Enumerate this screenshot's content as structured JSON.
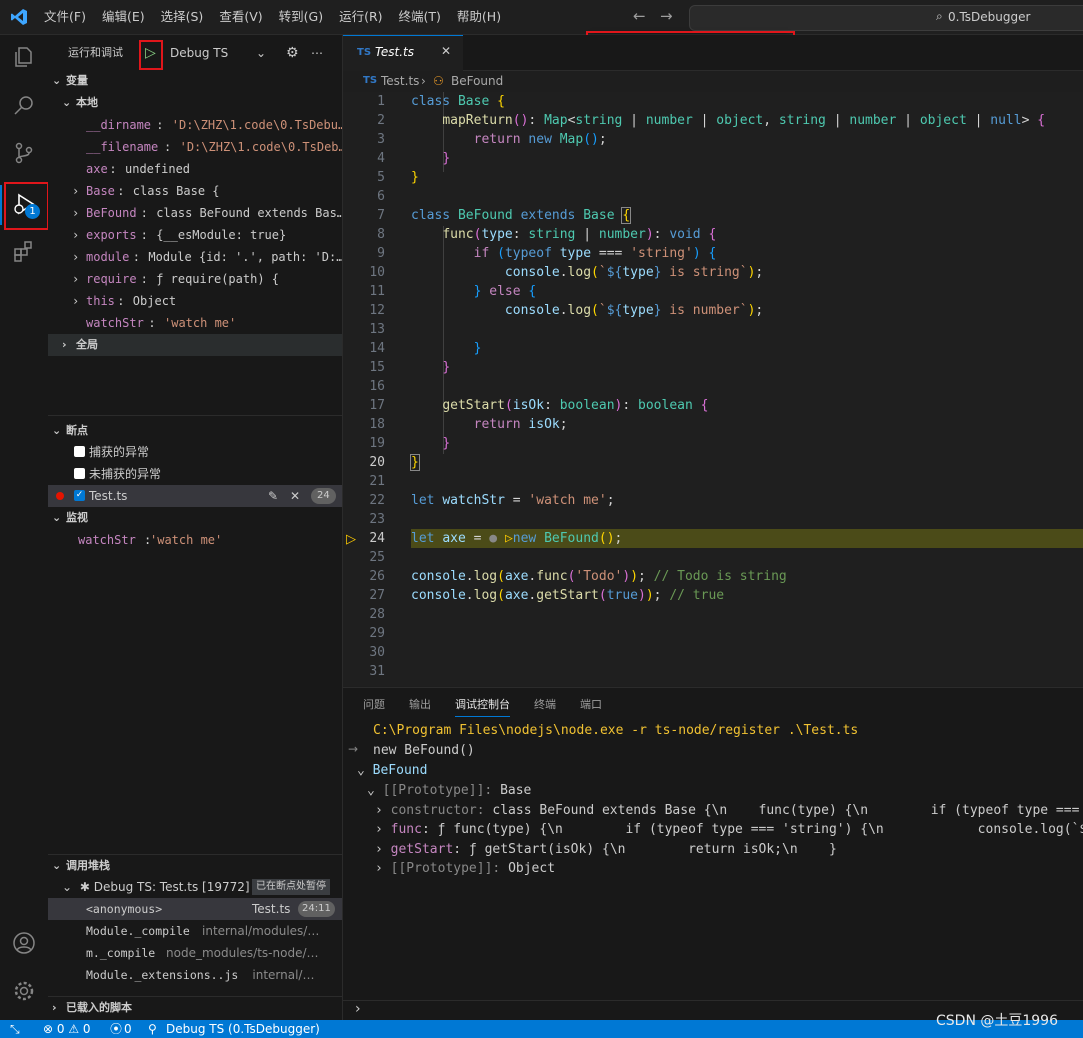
{
  "menu": [
    "文件(F)",
    "编辑(E)",
    "选择(S)",
    "查看(V)",
    "转到(G)",
    "运行(R)",
    "终端(T)",
    "帮助(H)"
  ],
  "search_text": "0.TsDebugger",
  "sidebar": {
    "title": "运行和调试",
    "config": "Debug TS",
    "variables_header": "变量",
    "local_header": "本地",
    "variables": [
      {
        "name": "__dirname",
        "value": "'D:\\ZHZ\\1.code\\0.TsDebu…",
        "kind": "str",
        "expand": false
      },
      {
        "name": "__filename",
        "value": "'D:\\ZHZ\\1.code\\0.TsDeb…",
        "kind": "str",
        "expand": false
      },
      {
        "name": "axe",
        "value": "undefined",
        "kind": "plain",
        "expand": false
      },
      {
        "name": "Base",
        "value": "class Base {",
        "kind": "plain",
        "expand": true
      },
      {
        "name": "BeFound",
        "value": "class BeFound extends Bas…",
        "kind": "plain",
        "expand": true
      },
      {
        "name": "exports",
        "value": "{__esModule: true}",
        "kind": "plain",
        "expand": true
      },
      {
        "name": "module",
        "value": "Module {id: '.', path: 'D:…",
        "kind": "plain",
        "expand": true
      },
      {
        "name": "require",
        "value": "ƒ require(path) {",
        "kind": "plain",
        "expand": true
      },
      {
        "name": "this",
        "value": "Object",
        "kind": "plain",
        "expand": true
      },
      {
        "name": "watchStr",
        "value": "'watch me'",
        "kind": "str",
        "expand": false
      }
    ],
    "global_header": "全局",
    "breakpoints_header": "断点",
    "breakpoints": [
      "捕获的异常",
      "未捕获的异常"
    ],
    "bp_file": "Test.ts",
    "bp_line": "24",
    "watch_header": "监视",
    "watch_name": "watchStr",
    "watch_value": "'watch me'",
    "callstack_header": "调用堆栈",
    "session": "Debug TS: Test.ts [19772]",
    "paused": "已在断点处暂停",
    "frames": [
      {
        "fn": "<anonymous>",
        "src": "Test.ts",
        "pos": "24:11"
      },
      {
        "fn": "Module._compile",
        "src": "internal/modules/…",
        "pos": ""
      },
      {
        "fn": "m._compile",
        "src": "node_modules/ts-node/…",
        "pos": ""
      },
      {
        "fn": "Module._extensions..js",
        "src": "internal/…",
        "pos": ""
      }
    ],
    "loaded_scripts": "已载入的脚本",
    "debug_badge": "1"
  },
  "editor": {
    "tab": "Test.ts",
    "tab_lang": "TS",
    "breadcrumb_file": "Test.ts",
    "breadcrumb_symbol": "BeFound",
    "line_numbers": [
      "1",
      "2",
      "3",
      "4",
      "5",
      "6",
      "7",
      "8",
      "9",
      "10",
      "11",
      "12",
      "13",
      "14",
      "15",
      "16",
      "17",
      "18",
      "19",
      "20",
      "21",
      "22",
      "23",
      "24",
      "25",
      "26",
      "27",
      "28",
      "29",
      "30",
      "31"
    ]
  },
  "panel": {
    "tabs": [
      "问题",
      "输出",
      "调试控制台",
      "终端",
      "端口"
    ],
    "cmd": "C:\\Program Files\\nodejs\\node.exe -r ts-node/register .\\Test.ts",
    "input": "new BeFound()",
    "result": "BeFound",
    "proto": "[[Prototype]]",
    "proto_val": "Base",
    "constructor": "constructor",
    "constructor_val": "class BeFound extends Base {\\n    func(type) {\\n        if (typeof type === '$",
    "func": "func",
    "func_val": "ƒ func(type) {\\n        if (typeof type === 'string') {\\n            console.log(`${t",
    "getStart": "getStart",
    "getStart_val": "ƒ getStart(isOk) {\\n        return isOk;\\n    }",
    "proto2": "[[Prototype]]",
    "proto2_val": "Object"
  },
  "status": {
    "errors": "⊗ 0 ⚠ 0",
    "ports": "0",
    "debug": "Debug TS (0.TsDebugger)",
    "watermark": "CSDN @土豆1996"
  },
  "colors": {
    "accent": "#0078d4",
    "highlight": "#e0161b",
    "breakpoint_line": "#4b4b18"
  }
}
